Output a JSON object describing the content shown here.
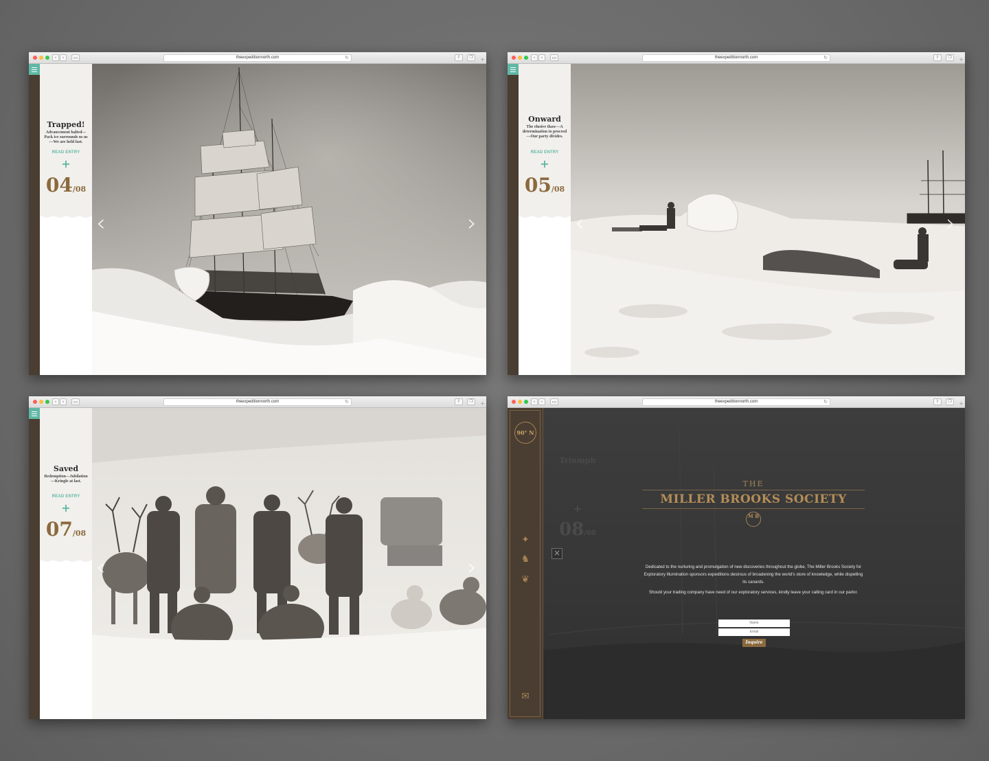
{
  "browser": {
    "url": "theexpeditionnorth.com"
  },
  "slides": [
    {
      "title": "Trapped!",
      "subtitle": "Advancement halted—Pack ice surrounds us us—We are held fast.",
      "link": "READ ENTRY",
      "plus": "+",
      "number": "04",
      "total": "/08",
      "photo": "ship trapped in pack ice"
    },
    {
      "title": "Onward",
      "subtitle": "The elusive thaw—A determination to proceed—Our party divides.",
      "link": "READ ENTRY",
      "plus": "+",
      "number": "05",
      "total": "/08",
      "photo": "dog sledges crossing ice toward ship"
    },
    {
      "title": "Saved",
      "subtitle": "Redemption—Jubilation—Kringle at last.",
      "link": "READ ENTRY",
      "plus": "+",
      "number": "07",
      "total": "/08",
      "photo": "expedition party with reindeer and dogs"
    }
  ],
  "society": {
    "logo_text": "90° N",
    "ghost_title": "Triumph",
    "ghost_number": "08",
    "ghost_total": "/08",
    "close_icon": "×",
    "the": "THE",
    "name": "MILLER BROOKS SOCIETY",
    "monogram": "M B",
    "paragraph1": "Dedicated to the nurturing and promulgation of new discoveries throughout the globe, The Miller Brooks Society for Exploratory Illumination sponsors expeditions desirous of broadening the world's store of knowledge, while dispelling its canards.",
    "paragraph2": "Should your trading company have need of our exploratory services, kindly leave your calling card in our parlor.",
    "name_placeholder": "Name",
    "email_placeholder": "Email",
    "button": "Inquire"
  },
  "icons": {
    "prev": "‹",
    "next": "›"
  },
  "colors": {
    "accent_teal": "#5fb8a5",
    "brand_brown": "#4a3d31",
    "gold": "#b48e57",
    "number_bronze": "#8a6a3e"
  }
}
